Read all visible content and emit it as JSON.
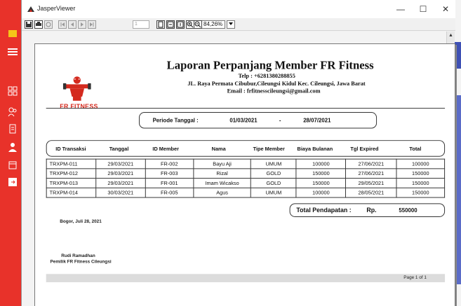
{
  "window": {
    "title": "JasperViewer",
    "minimize_glyph": "—",
    "maximize_glyph": "☐",
    "close_glyph": "✕"
  },
  "toolbar": {
    "page_number": "1",
    "zoom_value": "84,26%",
    "icons": [
      "save-icon",
      "print-icon",
      "reload-icon",
      "first-page-icon",
      "previous-page-icon",
      "next-page-icon",
      "last-page-icon",
      "actual-size-icon",
      "fit-width-icon",
      "fit-page-icon",
      "zoom-in-icon",
      "zoom-out-icon",
      "zoom-dropdown-icon"
    ]
  },
  "background_app": {
    "accent_color": "#e8322a",
    "right_block_color": "#3f51b5"
  },
  "report": {
    "brand": "FR FITNESS",
    "brand_color": "#d42a1e",
    "title": "Laporan Perpanjang Member FR Fitness",
    "telp": "Telp : +6281380288855",
    "address": "JL. Raya Permata Cibubur,Cileungsi Kidul Kec. Cileungsi, Jawa Barat",
    "email": "Email : frfitnesscileungsi@gmail.com",
    "period_label": "Periode Tanggal :",
    "period_start": "01/03/2021",
    "period_separator": "-",
    "period_end": "28/07/2021",
    "columns": [
      "ID Transaksi",
      "Tanggal",
      "ID Member",
      "Nama",
      "Tipe Member",
      "Biaya Bulanan",
      "Tgl Expired",
      "Total"
    ],
    "rows": [
      [
        "TRXPM-011",
        "29/03/2021",
        "FR-002",
        "Bayu Aji",
        "UMUM",
        "100000",
        "27/06/2021",
        "100000"
      ],
      [
        "TRXPM-012",
        "29/03/2021",
        "FR-003",
        "Rizal",
        "GOLD",
        "150000",
        "27/06/2021",
        "150000"
      ],
      [
        "TRXPM-013",
        "29/03/2021",
        "FR-001",
        "Imam Wicakso",
        "GOLD",
        "150000",
        "29/05/2021",
        "150000"
      ],
      [
        "TRXPM-014",
        "30/03/2021",
        "FR-005",
        "Agus",
        "UMUM",
        "100000",
        "28/05/2021",
        "150000"
      ]
    ],
    "total_label": "Total Pendapatan :",
    "total_currency": "Rp.",
    "total_value": "550000",
    "sign_place": "Bogor, Juli 28, 2021",
    "signer_name": "Rudi Ramadhan",
    "signer_role": "Pemilik FR Fitness Cileungsi",
    "page_label": "Page 1 of 1"
  }
}
